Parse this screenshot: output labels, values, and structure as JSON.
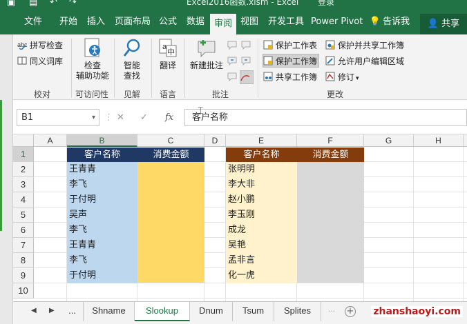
{
  "titlebar": {
    "text": "Excel2016函数.xlsm  -  Excel",
    "login": "登录"
  },
  "ribbon_tabs": [
    {
      "label": "文件"
    },
    {
      "label": "开始"
    },
    {
      "label": "插入"
    },
    {
      "label": "页面布局"
    },
    {
      "label": "公式"
    },
    {
      "label": "数据"
    },
    {
      "label": "审阅",
      "active": true
    },
    {
      "label": "视图"
    },
    {
      "label": "开发工具"
    },
    {
      "label": "Power Pivot"
    },
    {
      "label": "告诉我"
    }
  ],
  "share_label": "共享",
  "groups": {
    "proofing": {
      "label": "校对",
      "spell": "拼写检查",
      "thesaurus": "同义词库"
    },
    "accessibility": {
      "label": "可访问性",
      "check": "检查\n辅助功能"
    },
    "insights": {
      "label": "见解",
      "smart": "智能\n查找"
    },
    "language": {
      "label": "语言",
      "translate": "翻译"
    },
    "comments": {
      "label": "批注",
      "new_comment": "新建批注"
    },
    "changes": {
      "label": "更改",
      "protect_sheet": "保护工作表",
      "protect_workbook": "保护工作簿",
      "share_workbook": "共享工作簿",
      "protect_share": "保护并共享工作簿",
      "allow_edit": "允许用户编辑区域",
      "track": "修订"
    }
  },
  "formula_bar": {
    "namebox": "B1",
    "cancel": "✕",
    "enter": "✓",
    "fx": "fx",
    "content": "客户名称"
  },
  "columns": [
    "A",
    "B",
    "C",
    "D",
    "E",
    "F",
    "G",
    "H"
  ],
  "rows": [
    "1",
    "2",
    "3",
    "4",
    "5",
    "6",
    "7",
    "8",
    "9",
    "10"
  ],
  "table1": {
    "header": [
      "客户名称",
      "消费金额"
    ],
    "names": [
      "王青青",
      "李飞",
      "于付明",
      "吴声",
      "李飞",
      "王青青",
      "李飞",
      "于付明"
    ]
  },
  "table2": {
    "header": [
      "客户名称",
      "消费金额"
    ],
    "names": [
      "张明明",
      "李大非",
      "赵小鹏",
      "李玉刚",
      "成龙",
      "吴艳",
      "孟非言",
      "化一虎"
    ]
  },
  "colors": {
    "excel_green": "#217346",
    "t1_header": "#1f3864",
    "t1_names": "#bdd7ee",
    "t1_values": "#ffd966",
    "t2_header": "#843c0c",
    "t2_names": "#fff2cc",
    "t2_values": "#d9d9d9"
  },
  "sheet_tabs": {
    "ellipsis": "...",
    "tabs": [
      "Shname",
      "Slookup",
      "Dnum",
      "Tsum",
      "Splites"
    ],
    "active": "Slookup"
  },
  "watermark": "zhanshaoyi.com"
}
